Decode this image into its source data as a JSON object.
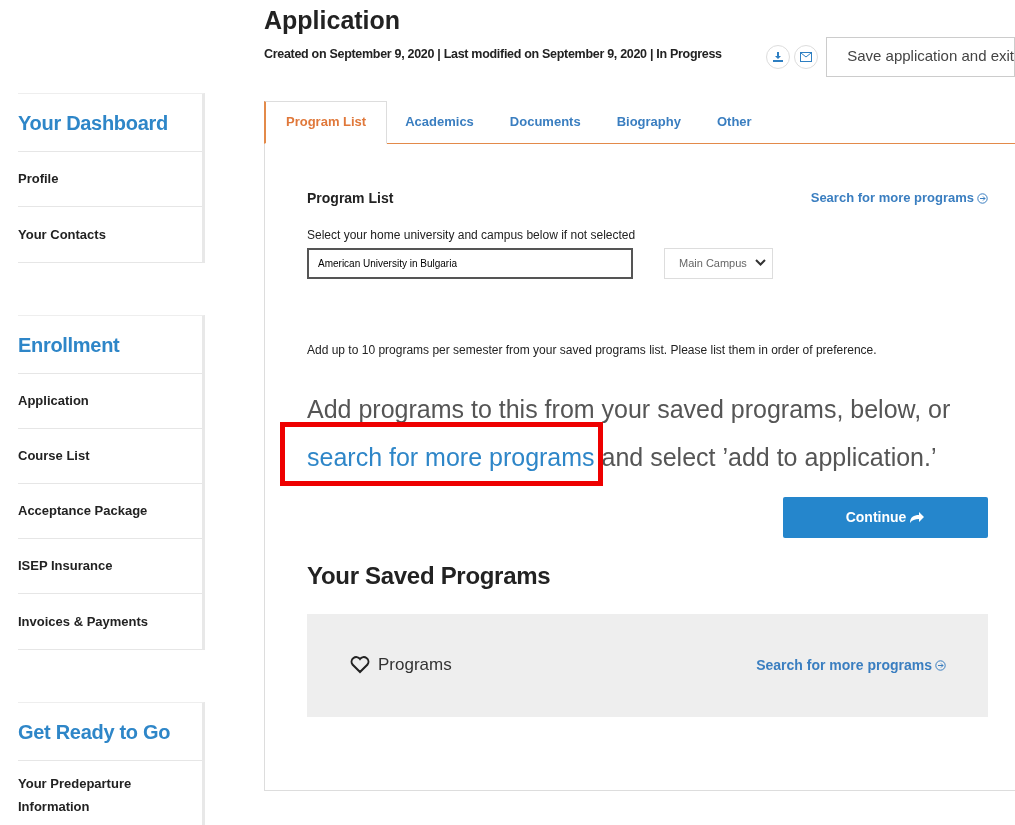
{
  "sidebar": [
    {
      "heading": "Your Dashboard",
      "items": [
        {
          "label": "Profile"
        },
        {
          "label": "Your Contacts"
        }
      ]
    },
    {
      "heading": "Enrollment",
      "items": [
        {
          "label": "Application"
        },
        {
          "label": "Course List"
        },
        {
          "label": "Acceptance Package"
        },
        {
          "label": "ISEP Insurance"
        },
        {
          "label": "Invoices & Payments"
        }
      ]
    },
    {
      "heading": "Get Ready to Go",
      "items": [
        {
          "label": "Your Predeparture Information"
        }
      ]
    }
  ],
  "page": {
    "title": "Application",
    "meta": "Created on September 9, 2020 | Last modified on September 9, 2020 | In Progress",
    "save_button": "Save application and exit"
  },
  "tabs": [
    {
      "label": "Program List",
      "selected": true
    },
    {
      "label": "Academics",
      "selected": false
    },
    {
      "label": "Documents",
      "selected": false
    },
    {
      "label": "Biography",
      "selected": false
    },
    {
      "label": "Other",
      "selected": false
    }
  ],
  "program_list": {
    "heading": "Program List",
    "search_link": "Search for more programs",
    "field_label": "Select your home university and campus below if not selected",
    "university": "American University in Bulgaria",
    "campus": "Main Campus",
    "instruction": "Add up to 10 programs per semester from your saved programs list. Please list them in order of preference.",
    "prompt_before": "Add programs to this from your saved programs, below, or",
    "prompt_link": "search for more programs",
    "prompt_after": "and select ’add to application.’",
    "link_highlighted": true,
    "continue_button": "Continue"
  },
  "saved": {
    "heading": "Your Saved Programs",
    "label": "Programs",
    "search_link": "Search for more programs"
  }
}
